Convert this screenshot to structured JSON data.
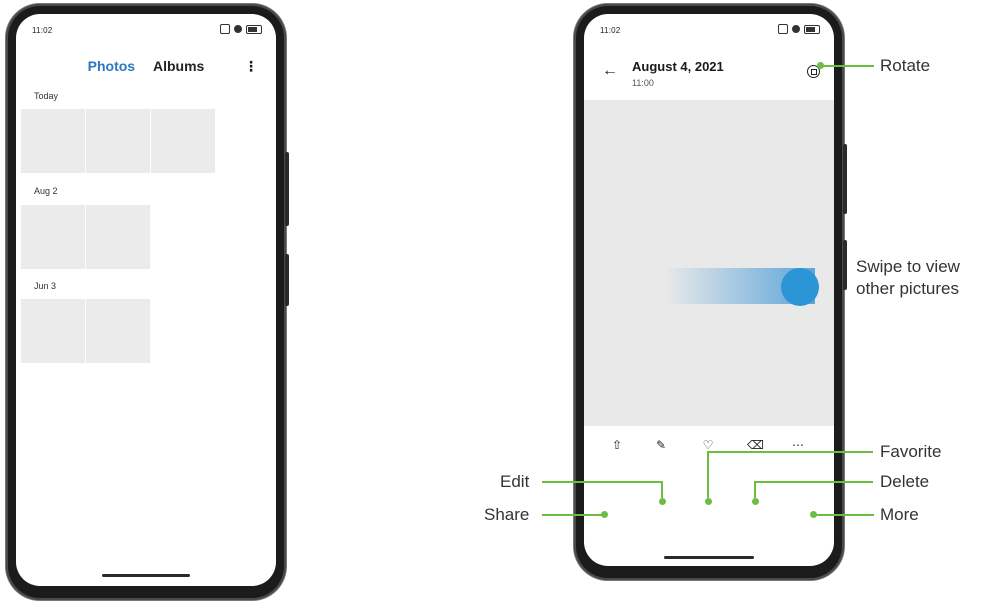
{
  "left_phone": {
    "status_time": "11:02",
    "tabs": [
      "Photos",
      "Albums"
    ],
    "active_tab": "Photos",
    "more_menu_glyph": "⋮",
    "sections": [
      {
        "label": "Today",
        "thumb_count": 3
      },
      {
        "label": "Aug 2",
        "thumb_count": 2
      },
      {
        "label": "Jun 3",
        "thumb_count": 2
      }
    ]
  },
  "right_phone": {
    "status_time": "11:02",
    "date": "August 4, 2021",
    "time": "11:00",
    "back_glyph": "←",
    "toolbar_icons": [
      "share-icon",
      "edit-icon",
      "favorite-icon",
      "delete-icon",
      "more-icon"
    ]
  },
  "callouts": {
    "rotate": "Rotate",
    "swipe": "Swipe to view other pictures",
    "favorite": "Favorite",
    "delete": "Delete",
    "more": "More",
    "edit": "Edit",
    "share": "Share"
  },
  "colors": {
    "accent_tab": "#2a78c1",
    "callout_line": "#6dbd45",
    "swipe_dot": "#2c95d6"
  }
}
